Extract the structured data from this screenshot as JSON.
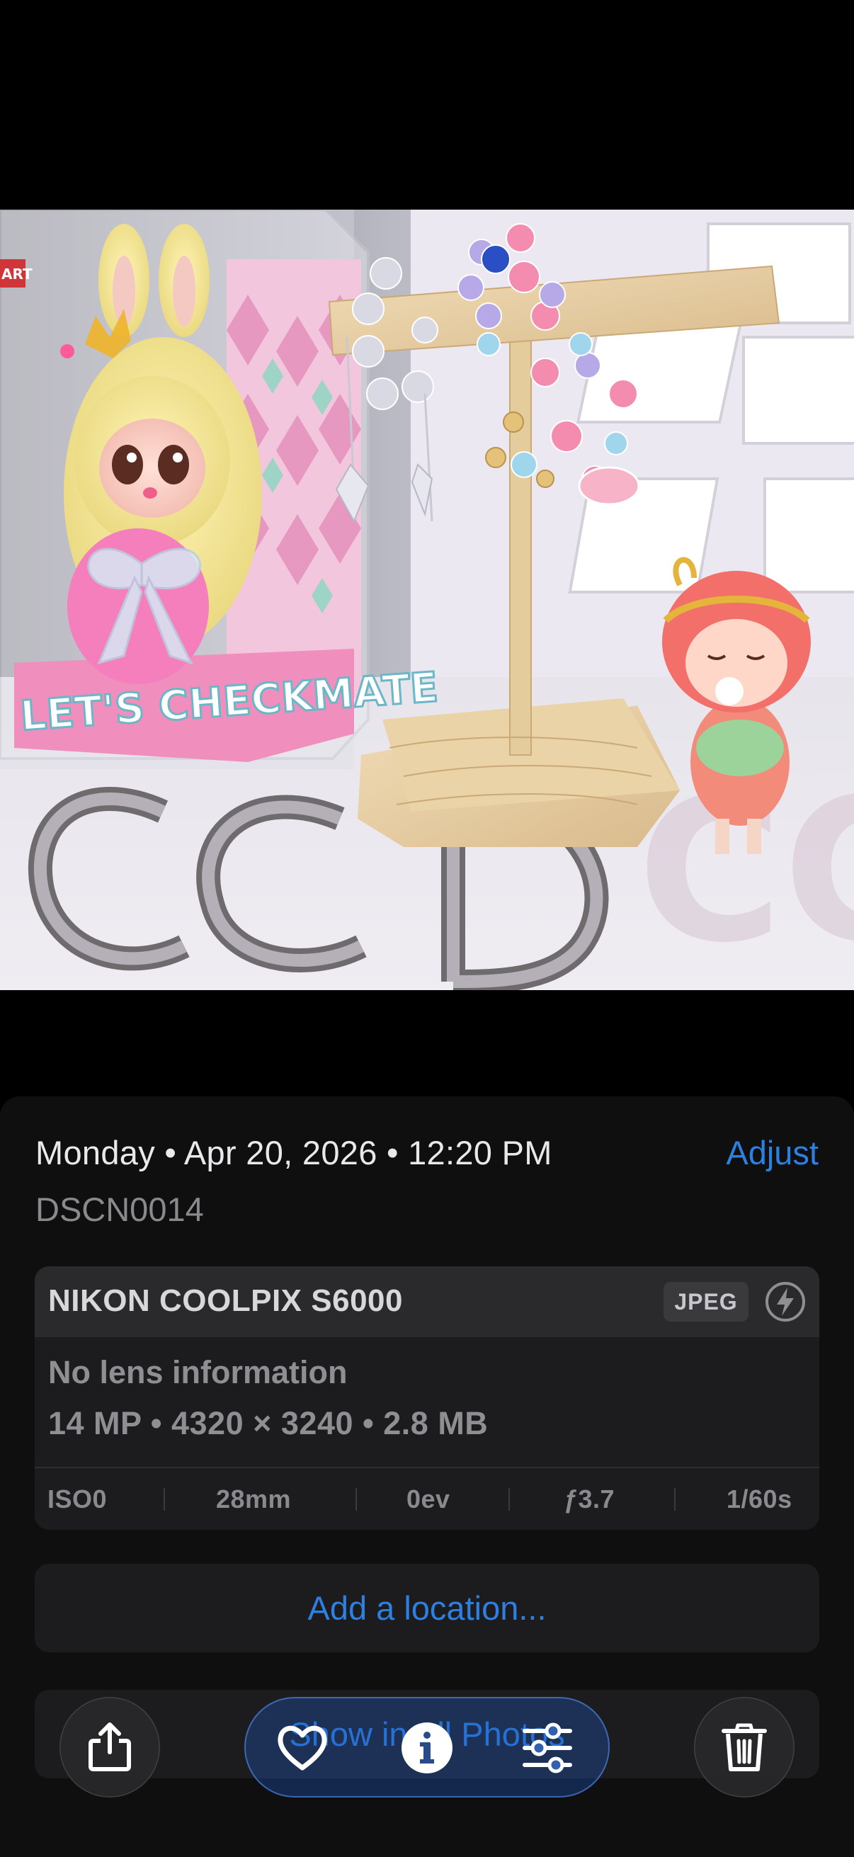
{
  "photo": {
    "box_text": "LET'S CHECKMATE",
    "box_corner_text": "ART",
    "rug_text": "CCD"
  },
  "info": {
    "date": "Monday • Apr 20, 2026 • 12:20 PM",
    "adjust_label": "Adjust",
    "filename": "DSCN0014"
  },
  "camera": {
    "name": "NIKON COOLPIX S6000",
    "format": "JPEG",
    "lens": "No lens information",
    "specs": "14 MP • 4320 × 3240 • 2.8 MB",
    "exif": {
      "iso": "ISO0",
      "focal": "28mm",
      "ev": "0ev",
      "aperture": "ƒ3.7",
      "shutter": "1/60s"
    }
  },
  "location_label": "Add a location...",
  "library_label": "Show in All Photos",
  "toolbar": {
    "share": "share-icon",
    "favorite": "heart-icon",
    "info": "info-icon",
    "edit": "sliders-icon",
    "delete": "trash-icon"
  },
  "colors": {
    "accent": "#2d7fe0",
    "sheet_bg": "#0f0f10",
    "card_bg": "#1c1c1e"
  }
}
